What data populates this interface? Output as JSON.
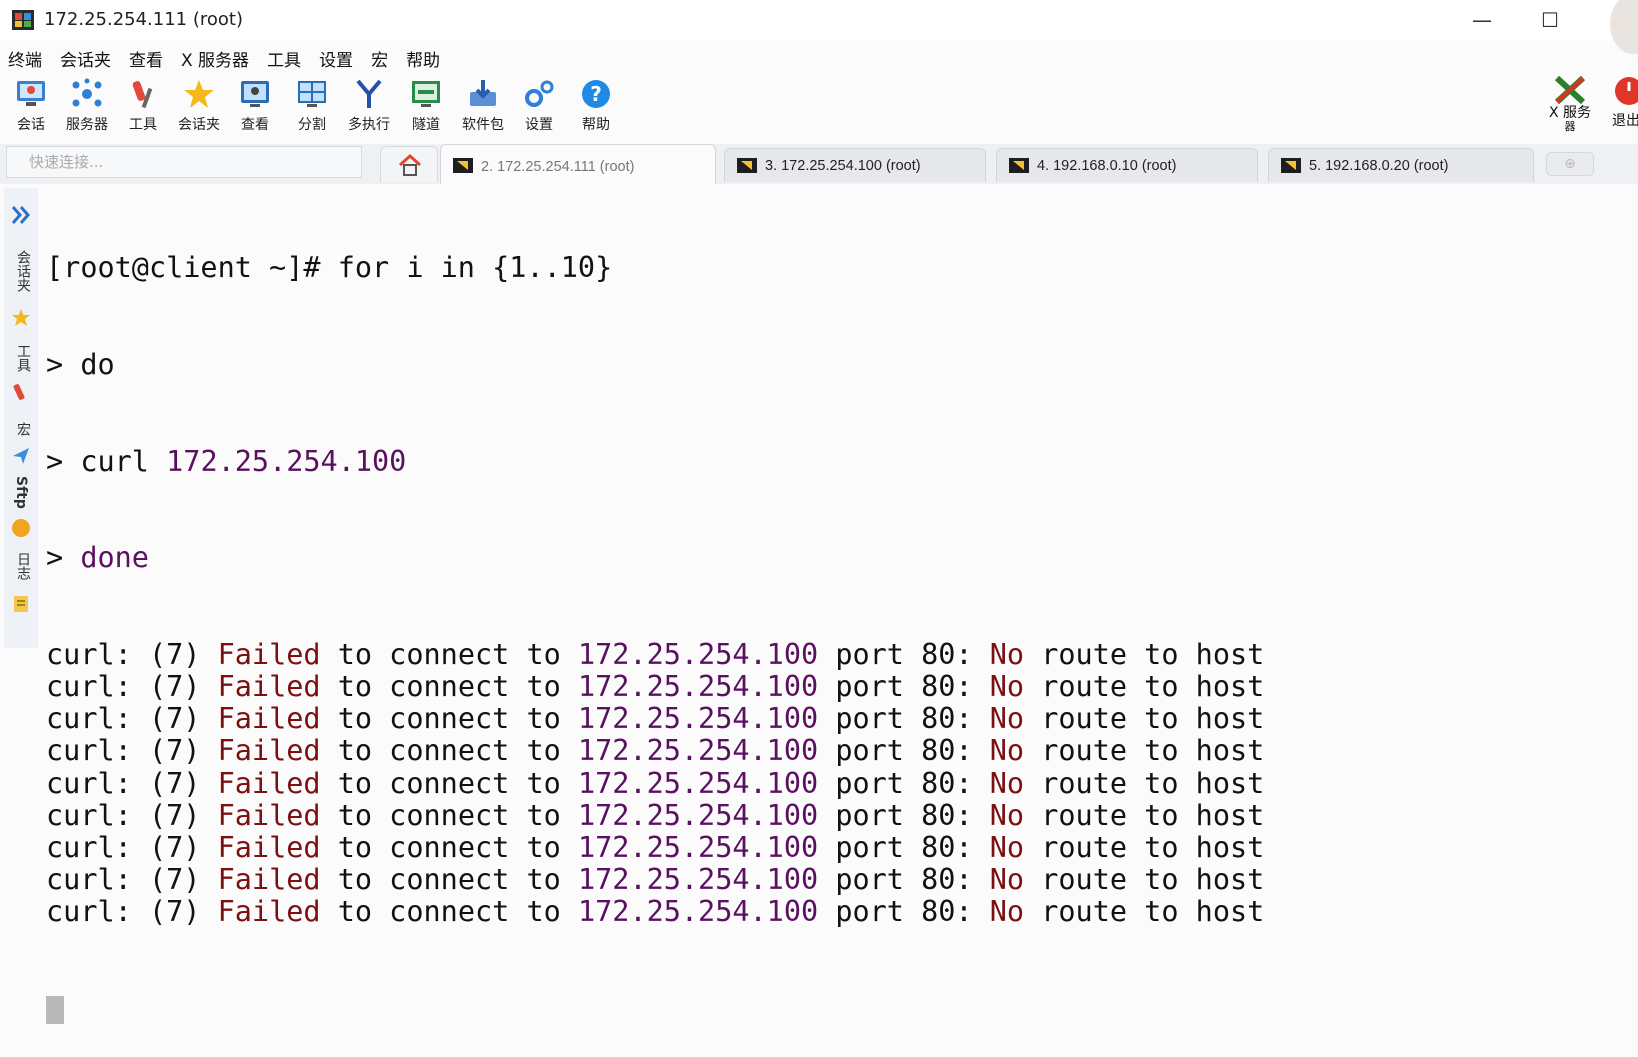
{
  "window": {
    "title": "172.25.254.111 (root)",
    "controls": [
      "—",
      "☐"
    ]
  },
  "menu": [
    "终端",
    "会话夹",
    "查看",
    "X 服务器",
    "工具",
    "设置",
    "宏",
    "帮助"
  ],
  "toolbar": {
    "items": [
      {
        "label": "会话",
        "icon": "session-icon"
      },
      {
        "label": "服务器",
        "icon": "servers-icon"
      },
      {
        "label": "工具",
        "icon": "tools-icon"
      },
      {
        "label": "会话夹",
        "icon": "star-icon"
      },
      {
        "label": "查看",
        "icon": "view-icon"
      },
      {
        "label": "分割",
        "icon": "split-icon"
      },
      {
        "label": "多执行",
        "icon": "multiexec-icon"
      },
      {
        "label": "隧道",
        "icon": "tunnel-icon"
      },
      {
        "label": "软件包",
        "icon": "packages-icon"
      },
      {
        "label": "设置",
        "icon": "settings-icon"
      },
      {
        "label": "帮助",
        "icon": "help-icon"
      }
    ],
    "xserver_label_1": "X 服务",
    "xserver_label_2": "器",
    "exit_label": "退出"
  },
  "quick_connect_placeholder": "快速连接...",
  "tabs": [
    {
      "label": "2. 172.25.254.111 (root)",
      "active": true
    },
    {
      "label": "3. 172.25.254.100 (root)",
      "active": false
    },
    {
      "label": "4. 192.168.0.10 (root)",
      "active": false
    },
    {
      "label": "5. 192.168.0.20 (root)",
      "active": false
    }
  ],
  "side_panel": [
    "会话夹",
    "工具",
    "宏",
    "Sftp",
    "日志"
  ],
  "terminal": {
    "prompt": "[root@client ~]# ",
    "command": "for i in {1..10}",
    "cont_prefix": "> ",
    "line_do": "do",
    "line_curl": "curl ",
    "curl_ip": "172.25.254.100",
    "line_done": "done",
    "error": {
      "prefix": "curl: (7) ",
      "failed": "Failed",
      "mid": " to connect to ",
      "ip": "172.25.254.100",
      "port": " port 80: ",
      "no": "No",
      "tail": " route to host"
    },
    "error_count": 9
  }
}
